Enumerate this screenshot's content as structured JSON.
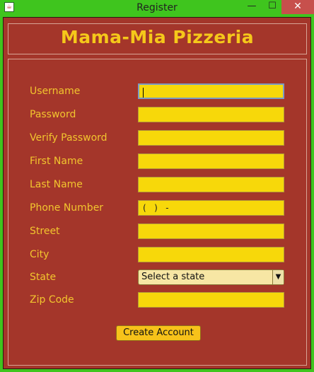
{
  "window": {
    "title": "Register",
    "minimize": "—",
    "maximize": "☐",
    "close": "✕"
  },
  "header": {
    "title": "Mama-Mia Pizzeria"
  },
  "form": {
    "username_label": "Username",
    "username_value": "",
    "password_label": "Password",
    "verify_password_label": "Verify Password",
    "first_name_label": "First Name",
    "last_name_label": "Last Name",
    "phone_label": "Phone Number",
    "phone_value": "(   )   -",
    "street_label": "Street",
    "city_label": "City",
    "state_label": "State",
    "state_selected": "Select a state",
    "zip_label": "Zip Code",
    "submit_label": "Create Account"
  },
  "colors": {
    "window_border": "#3fc51e",
    "panel_background": "#a4362a",
    "title_text": "#f5c81a",
    "label_text": "#f2c52e",
    "input_background": "#f7d80a",
    "button_background": "#f7c21a"
  },
  "icons": {
    "app": "java-cup-icon",
    "state_dropdown": "chevron-down-icon"
  }
}
